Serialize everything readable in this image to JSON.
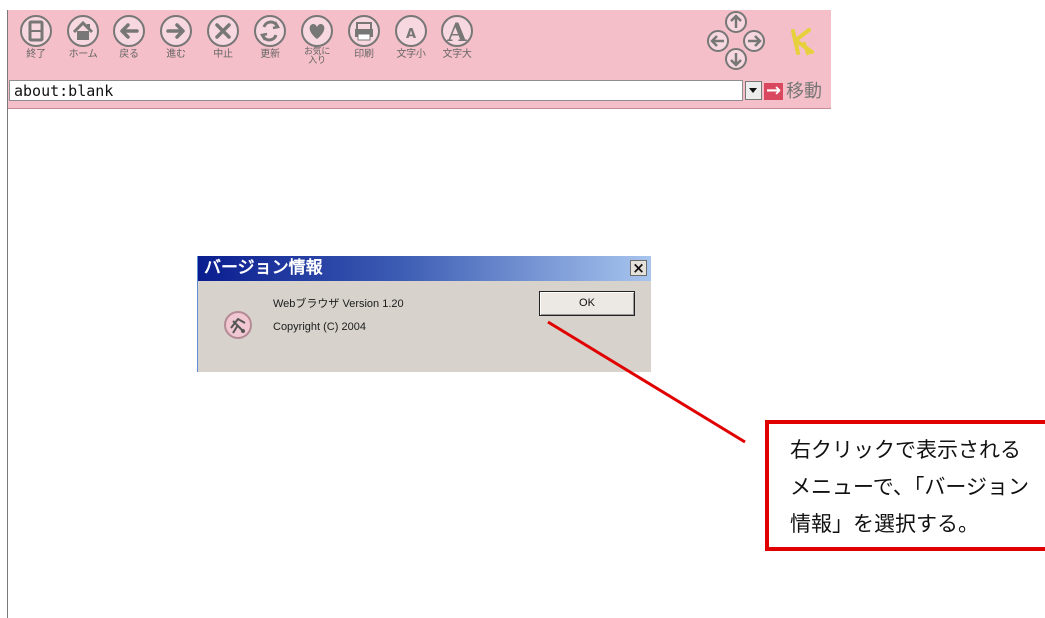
{
  "toolbar": {
    "buttons": [
      {
        "label": "終了",
        "icon": "exit-icon"
      },
      {
        "label": "ホーム",
        "icon": "home-icon"
      },
      {
        "label": "戻る",
        "icon": "back-arrow-icon"
      },
      {
        "label": "進む",
        "icon": "forward-arrow-icon"
      },
      {
        "label": "中止",
        "icon": "stop-icon"
      },
      {
        "label": "更新",
        "icon": "refresh-icon"
      },
      {
        "label": "お気に\n入り",
        "icon": "favorite-heart-icon"
      },
      {
        "label": "印刷",
        "icon": "printer-icon"
      },
      {
        "label": "文字小",
        "icon": "small-text-icon",
        "glyph": "A"
      },
      {
        "label": "文字大",
        "icon": "large-text-icon",
        "glyph": "A"
      }
    ],
    "arrow_pad_icon": "direction-arrows-icon",
    "logo_icon": "browser-logo-icon"
  },
  "address_bar": {
    "value": "about:blank",
    "dropdown_icon": "chevron-down-icon",
    "go_label": "移動",
    "go_icon": "right-arrow-icon"
  },
  "dialog": {
    "title": "バージョン情報",
    "close_label": "×",
    "version": "Webブラウザ Version 1.20",
    "copyright": "Copyright (C) 2004",
    "ok_label": "OK",
    "logo_icon": "app-logo-icon"
  },
  "annotation": {
    "lines": [
      "右クリックで表示される",
      "メニューで、「バージョン",
      "情報」を選択する。"
    ],
    "color": "#e00000"
  },
  "colors": {
    "toolbar": "#f4bfc8",
    "icon_fill": "#f8d8e0",
    "icon_stroke": "#7d7d7d",
    "dialog_title_start": "#0a1d8f",
    "dialog_title_end": "#a8c5ee",
    "annotation": "#e00000"
  }
}
